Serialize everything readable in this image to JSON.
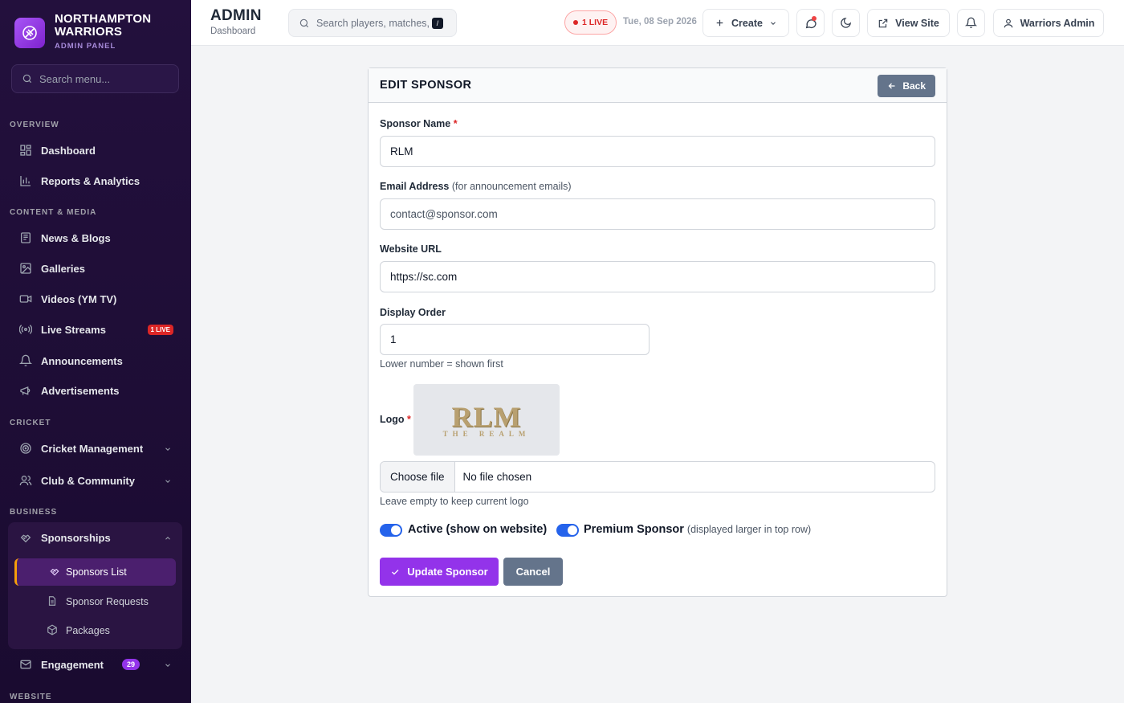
{
  "brand": {
    "name_line1": "NORTHAMPTON",
    "name_line2": "WARRIORS",
    "subtitle": "ADMIN PANEL"
  },
  "sidebar": {
    "search_placeholder": "Search menu...",
    "sections": {
      "overview": "OVERVIEW",
      "content": "CONTENT & MEDIA",
      "cricket": "CRICKET",
      "business": "BUSINESS",
      "website": "WEBSITE"
    },
    "items": {
      "dashboard": "Dashboard",
      "reports": "Reports & Analytics",
      "news": "News & Blogs",
      "galleries": "Galleries",
      "videos": "Videos (YM TV)",
      "live_streams": "Live Streams",
      "live_streams_badge": "1 LIVE",
      "announcements": "Announcements",
      "advertisements": "Advertisements",
      "cricket_mgmt": "Cricket Management",
      "club": "Club & Community",
      "sponsorships": "Sponsorships",
      "sponsors_list": "Sponsors List",
      "sponsor_requests": "Sponsor Requests",
      "packages": "Packages",
      "engagement": "Engagement",
      "engagement_badge": "29"
    }
  },
  "topbar": {
    "title": "ADMIN",
    "breadcrumb": "Dashboard",
    "search_placeholder": "Search players, matches, r",
    "search_shortcut": "/",
    "live_label": "1 LIVE",
    "date": "Tue, 08 Sep 2026",
    "create_label": "Create",
    "view_site_label": "View Site",
    "user_label": "Warriors Admin"
  },
  "form": {
    "title": "EDIT SPONSOR",
    "back_label": "Back",
    "name_label": "Sponsor Name",
    "name_value": "RLM",
    "email_label": "Email Address",
    "email_hint": "(for announcement emails)",
    "email_placeholder": "contact@sponsor.com",
    "website_label": "Website URL",
    "website_value": "https://sc.com",
    "order_label": "Display Order",
    "order_value": "1",
    "order_help": "Lower number = shown first",
    "logo_label": "Logo",
    "logo_text": "RLM",
    "logo_subtext": "THE REALM",
    "file_button": "Choose file",
    "file_status": "No file chosen",
    "logo_help": "Leave empty to keep current logo",
    "active_label": "Active (show on website)",
    "active_on": true,
    "premium_label": "Premium Sponsor",
    "premium_hint": "(displayed larger in top row)",
    "premium_on": true,
    "submit_label": "Update Sponsor",
    "cancel_label": "Cancel"
  },
  "colors": {
    "accent": "#9333ea",
    "toggle": "#2563eb",
    "live": "#dc2626",
    "sidebar_bg": "#23103d"
  }
}
